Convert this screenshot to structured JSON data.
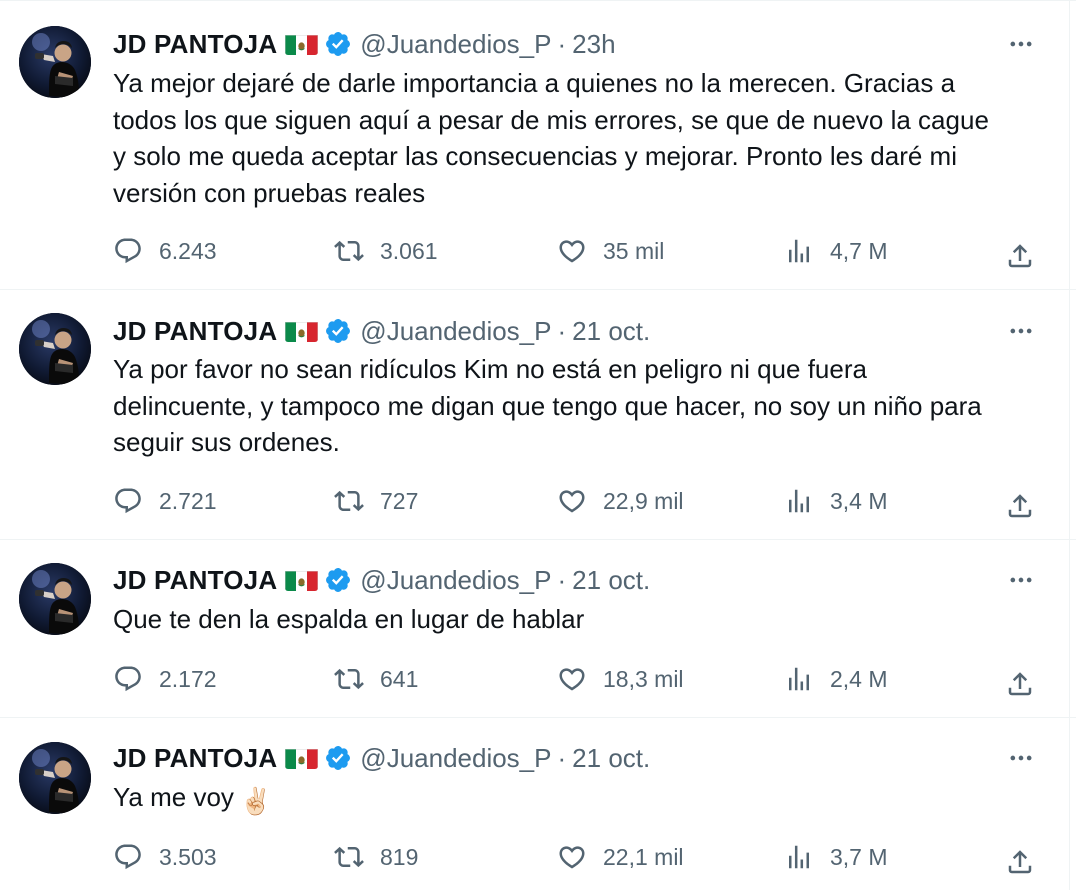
{
  "colors": {
    "text": "#0f1419",
    "secondary": "#536471",
    "verified": "#1d9bf0",
    "border": "#eff3f4"
  },
  "tweets": [
    {
      "name": "JD PANTOJA",
      "handle": "@Juandedios_P",
      "separator": "·",
      "time": "23h",
      "lines": [
        "Ya mejor dejaré de darle importancia a quienes no la merecen. Gracias a",
        "todos los que siguen aquí a pesar de mis errores, se que de nuevo la cague",
        "y solo me queda aceptar las consecuencias y mejorar. Pronto les daré mi",
        "versión con pruebas reales"
      ],
      "replies": "6.243",
      "reposts": "3.061",
      "likes": "35 mil",
      "views": "4,7 M"
    },
    {
      "name": "JD PANTOJA",
      "handle": "@Juandedios_P",
      "separator": "·",
      "time": "21 oct.",
      "lines": [
        "Ya por favor no sean ridículos Kim no está en peligro ni que fuera",
        "delincuente, y tampoco me digan que tengo que hacer, no soy un niño para",
        "seguir sus ordenes."
      ],
      "replies": "2.721",
      "reposts": "727",
      "likes": "22,9 mil",
      "views": "3,4 M"
    },
    {
      "name": "JD PANTOJA",
      "handle": "@Juandedios_P",
      "separator": "·",
      "time": "21 oct.",
      "lines": [
        "Que te den la espalda en lugar de hablar"
      ],
      "replies": "2.172",
      "reposts": "641",
      "likes": "18,3 mil",
      "views": "2,4 M"
    },
    {
      "name": "JD PANTOJA",
      "handle": "@Juandedios_P",
      "separator": "·",
      "time": "21 oct.",
      "lines": [
        "Ya me voy"
      ],
      "emoji": "✌🏻",
      "replies": "3.503",
      "reposts": "819",
      "likes": "22,1 mil",
      "views": "3,7 M"
    }
  ]
}
